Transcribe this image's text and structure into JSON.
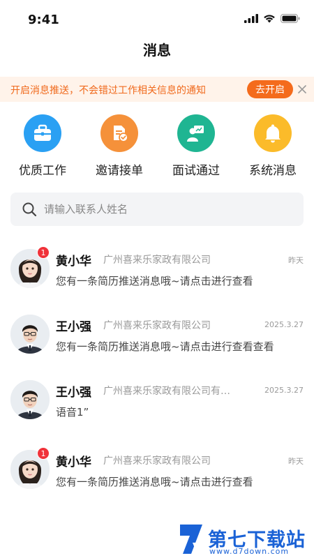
{
  "status_bar": {
    "time": "9:41"
  },
  "header": {
    "title": "消息"
  },
  "push_banner": {
    "text": "开启消息推送，不会错过工作相关信息的通知",
    "button_label": "去开启"
  },
  "quick_actions": [
    {
      "label": "优质工作",
      "icon": "briefcase-icon",
      "color": "#2aa0f3"
    },
    {
      "label": "邀请接单",
      "icon": "document-check-icon",
      "color": "#f5913a"
    },
    {
      "label": "面试通过",
      "icon": "interview-icon",
      "color": "#1fb592"
    },
    {
      "label": "系统消息",
      "icon": "bell-icon",
      "color": "#fbbb2a"
    }
  ],
  "search": {
    "placeholder": "请输入联系人姓名"
  },
  "messages": [
    {
      "name": "黄小华",
      "company": "广州喜来乐家政有限公司",
      "time": "昨天",
      "preview": "您有一条简历推送消息哦~请点击进行查看",
      "badge": "1",
      "avatar": "female-avatar"
    },
    {
      "name": "王小强",
      "company": "广州喜来乐家政有限公司",
      "time": "2025.3.27",
      "preview": "您有一条简历推送消息哦~请点击进行查看查看",
      "badge": "",
      "avatar": "male-avatar"
    },
    {
      "name": "王小强",
      "company": "广州喜来乐家政有限公司有限公司",
      "time": "2025.3.27",
      "preview": "语音1”",
      "badge": "",
      "avatar": "male-avatar"
    },
    {
      "name": "黄小华",
      "company": "广州喜来乐家政有限公司",
      "time": "昨天",
      "preview": "您有一条简历推送消息哦~请点击进行查看",
      "badge": "1",
      "avatar": "female-avatar"
    }
  ],
  "watermark": {
    "title": "第七下载站",
    "url": "www.d7down.com"
  }
}
